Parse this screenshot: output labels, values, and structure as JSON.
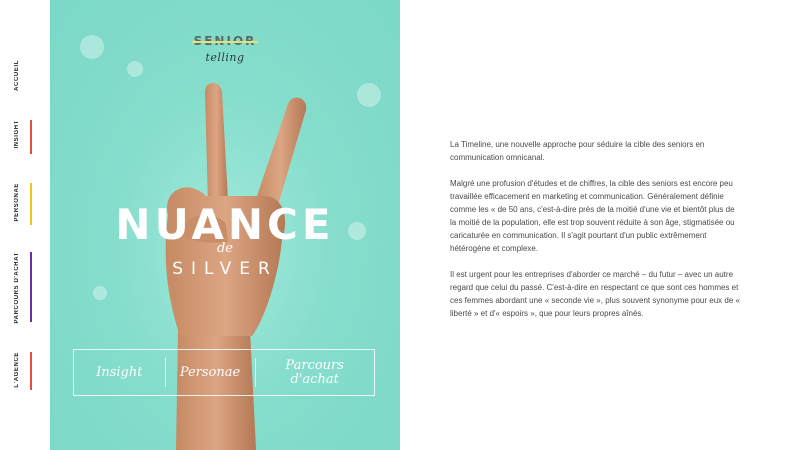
{
  "nav": {
    "items": [
      {
        "label": "ACCUEIL",
        "color": "#2a9e8c"
      },
      {
        "label": "INSIGHT",
        "color": "#e74c3c"
      },
      {
        "label": "PERSONAE",
        "color": "#f0c419"
      },
      {
        "label": "PARCOURS D'ACHAT",
        "color": "#6a2fa0"
      },
      {
        "label": "L'AGENCE",
        "color": "#e74c3c"
      }
    ]
  },
  "hero": {
    "background_color": "#86ddcc",
    "logo_main": "SENIOR",
    "logo_sub": "telling",
    "title": "NUANCE",
    "title_connector": "de",
    "subtitle": "SILVER",
    "menu": [
      {
        "label": "Insight"
      },
      {
        "label": "Personae"
      },
      {
        "label": "Parcours d'achat"
      }
    ]
  },
  "content": {
    "paragraphs": [
      "La Timeline, une nouvelle approche pour séduire la cible des seniors en communication omnicanal.",
      "Malgré une profusion d'études et de chiffres, la cible des seniors est encore peu travaillée efficacement en marketing et communication. Généralement définie comme les « de 50 ans, c'est-à-dire près de la moitié d'une vie et bientôt plus de la moitié de la population, elle est trop souvent réduite à son âge, stigmatisée ou caricaturée en communication. Il s'agit pourtant d'un public extrêmement hétérogène et complexe.",
      "Il est urgent pour les entreprises d'aborder ce marché – du futur – avec un autre regard que celui du passé. C'est-à-dire en respectant ce que sont ces hommes et ces femmes abordant une « seconde vie », plus souvent synonyme pour eux de « liberté » et d'« espoirs », que pour leurs propres aînés."
    ]
  }
}
